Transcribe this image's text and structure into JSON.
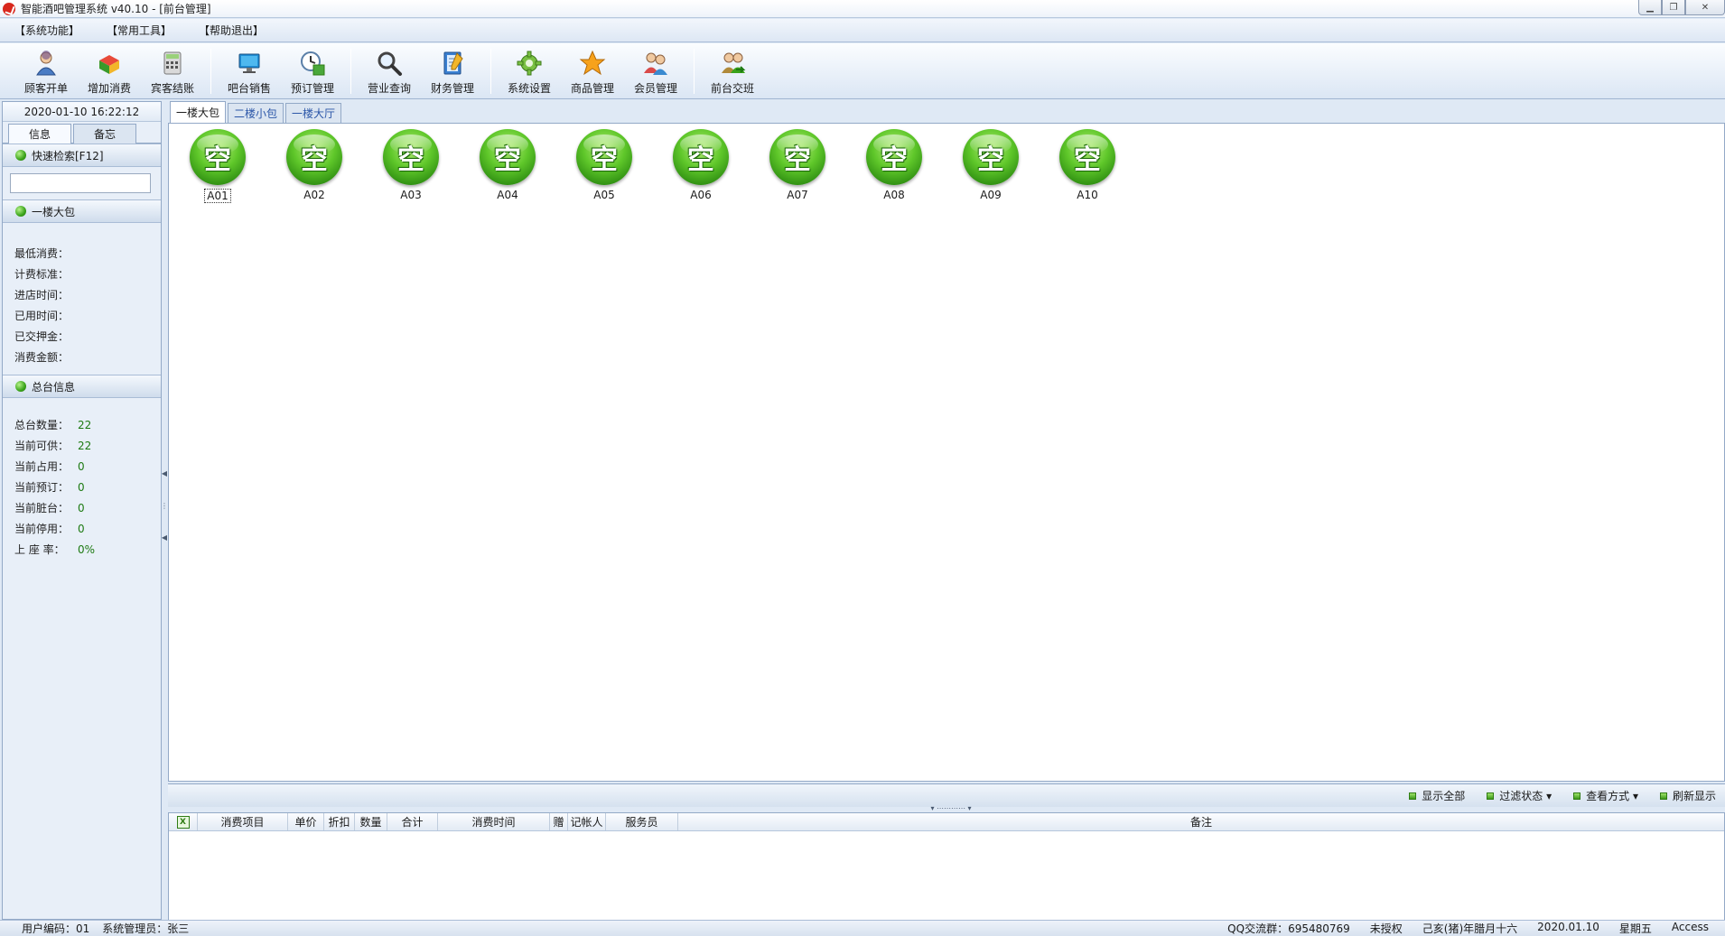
{
  "window": {
    "title": "智能酒吧管理系统 v40.10 - [前台管理]"
  },
  "menu": [
    "【系统功能】",
    "【常用工具】",
    "【帮助退出】"
  ],
  "toolbar": {
    "groups": [
      [
        {
          "label": "顾客开单",
          "icon": "customer-icon"
        },
        {
          "label": "增加消费",
          "icon": "add-consumption-icon"
        },
        {
          "label": "宾客结账",
          "icon": "calculator-icon"
        }
      ],
      [
        {
          "label": "吧台销售",
          "icon": "monitor-icon"
        },
        {
          "label": "预订管理",
          "icon": "clock-calendar-icon"
        }
      ],
      [
        {
          "label": "营业查询",
          "icon": "magnifier-icon"
        },
        {
          "label": "财务管理",
          "icon": "notebook-icon"
        }
      ],
      [
        {
          "label": "系统设置",
          "icon": "gear-icon"
        },
        {
          "label": "商品管理",
          "icon": "star-icon"
        },
        {
          "label": "会员管理",
          "icon": "members-icon"
        }
      ],
      [
        {
          "label": "前台交班",
          "icon": "shift-handover-icon"
        }
      ]
    ]
  },
  "left": {
    "datetime": "2020-01-10 16:22:12",
    "tabs": [
      "信息",
      "备忘"
    ],
    "quick_search": {
      "title": "快速检索[F12]",
      "value": ""
    },
    "room_section": {
      "title": "一楼大包",
      "fields": [
        "最低消费：",
        "计费标准：",
        "进店时间：",
        "已用时间：",
        "已交押金：",
        "消费金额："
      ]
    },
    "summary": {
      "title": "总台信息",
      "rows": [
        {
          "label": "总台数量：",
          "value": "22"
        },
        {
          "label": "当前可供：",
          "value": "22"
        },
        {
          "label": "当前占用：",
          "value": "0"
        },
        {
          "label": "当前预订：",
          "value": "0"
        },
        {
          "label": "当前脏台：",
          "value": "0"
        },
        {
          "label": "当前停用：",
          "value": "0"
        },
        {
          "label": "上 座 率：",
          "value": "0%"
        }
      ]
    }
  },
  "room_tabs": [
    "一楼大包",
    "二楼小包",
    "一楼大厅"
  ],
  "rooms": [
    {
      "name": "A01",
      "status": "空",
      "selected": true
    },
    {
      "name": "A02",
      "status": "空"
    },
    {
      "name": "A03",
      "status": "空"
    },
    {
      "name": "A04",
      "status": "空"
    },
    {
      "name": "A05",
      "status": "空"
    },
    {
      "name": "A06",
      "status": "空"
    },
    {
      "name": "A07",
      "status": "空"
    },
    {
      "name": "A08",
      "status": "空"
    },
    {
      "name": "A09",
      "status": "空"
    },
    {
      "name": "A10",
      "status": "空"
    }
  ],
  "filterbar": [
    "显示全部",
    "过滤状态 ▾",
    "查看方式 ▾",
    "刷新显示"
  ],
  "grid": {
    "columns": [
      "消费项目",
      "单价",
      "折扣",
      "数量",
      "合计",
      "消费时间",
      "赠",
      "记帐人",
      "服务员",
      "备注"
    ]
  },
  "status": {
    "left": [
      "用户编码：01",
      "系统管理员：张三"
    ],
    "right": [
      "QQ交流群：695480769",
      "未授权",
      "己亥(猪)年腊月十六",
      "2020.01.10",
      "星期五",
      "Access"
    ]
  },
  "colors": {
    "accent_green": "#3aa31a",
    "value_green": "#1d7a12",
    "panel_bg": "#e8eff8",
    "border": "#93a9c7"
  }
}
